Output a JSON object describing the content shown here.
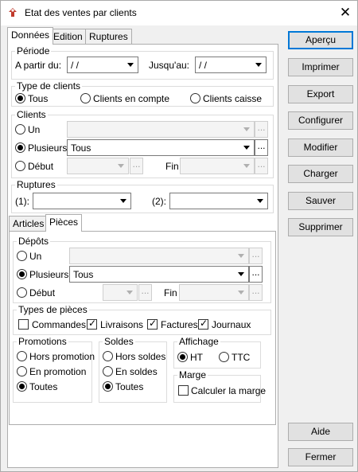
{
  "window": {
    "title": "Etat des ventes par clients",
    "close_glyph": "✕",
    "icon": "app-icon"
  },
  "tabs": [
    "Données",
    "Edition",
    "Ruptures"
  ],
  "periode": {
    "title": "Période",
    "from_label": "A partir du:",
    "from_value": " / /",
    "to_label": "Jusqu'au:",
    "to_value": " / /"
  },
  "type_clients": {
    "title": "Type de clients",
    "options": [
      "Tous",
      "Clients en compte",
      "Clients caisse"
    ],
    "selected": "Tous"
  },
  "clients": {
    "title": "Clients",
    "un_label": "Un",
    "plusieurs_label": "Plusieurs",
    "plusieurs_value": "Tous",
    "debut_label": "Début",
    "fin_label": "Fin",
    "selected": "Plusieurs",
    "dots": "..."
  },
  "ruptures": {
    "title": "Ruptures",
    "r1_label": "(1):",
    "r2_label": "(2):"
  },
  "subtabs": [
    "Articles",
    "Pièces"
  ],
  "depots": {
    "title": "Dépôts",
    "un_label": "Un",
    "plusieurs_label": "Plusieurs",
    "plusieurs_value": "Tous",
    "debut_label": "Début",
    "fin_label": "Fin",
    "selected": "Plusieurs"
  },
  "types_pieces": {
    "title": "Types de pièces",
    "items": [
      {
        "label": "Commandes",
        "checked": false
      },
      {
        "label": "Livraisons",
        "checked": true
      },
      {
        "label": "Factures",
        "checked": true
      },
      {
        "label": "Journaux",
        "checked": true
      }
    ]
  },
  "promotions": {
    "title": "Promotions",
    "options": [
      "Hors promotion",
      "En promotion",
      "Toutes"
    ],
    "selected": "Toutes"
  },
  "soldes": {
    "title": "Soldes",
    "options": [
      "Hors soldes",
      "En soldes",
      "Toutes"
    ],
    "selected": "Toutes"
  },
  "affichage": {
    "title": "Affichage",
    "options": [
      "HT",
      "TTC"
    ],
    "selected": "HT"
  },
  "marge": {
    "title": "Marge",
    "checkbox_label": "Calculer la marge",
    "checked": false
  },
  "buttons": {
    "apercu": "Aperçu",
    "imprimer": "Imprimer",
    "export": "Export",
    "configurer": "Configurer",
    "modifier": "Modifier",
    "charger": "Charger",
    "sauver": "Sauver",
    "supprimer": "Supprimer",
    "aide": "Aide",
    "fermer": "Fermer"
  },
  "colors": {
    "accent": "#0078d7",
    "face": "#f0f0f0",
    "button": "#e1e1e1"
  }
}
